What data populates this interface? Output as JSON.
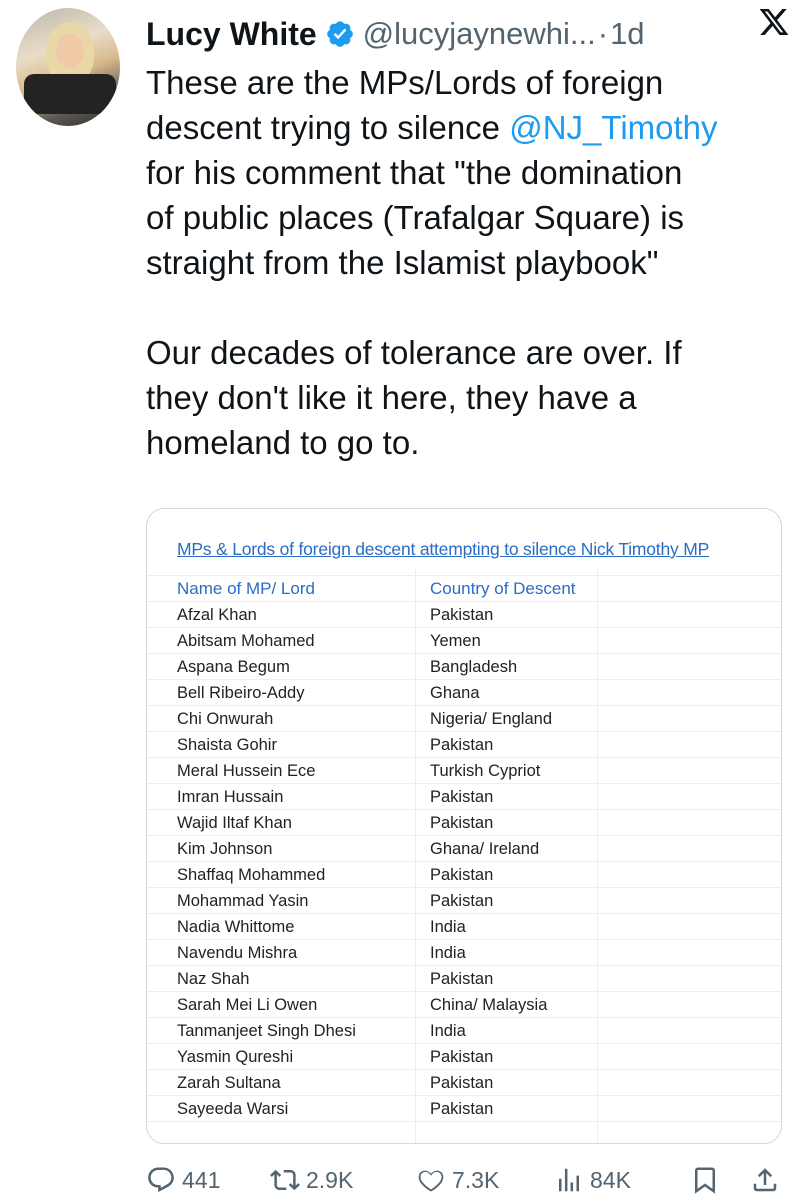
{
  "author": {
    "name": "Lucy White",
    "handle": "@lucyjaynewhi...",
    "separator": "·",
    "time": "1d"
  },
  "icons": {
    "verified": "verified-badge-icon",
    "logo": "x-logo-icon",
    "reply": "reply-icon",
    "repost": "repost-icon",
    "like": "like-icon",
    "views": "views-icon",
    "bookmark": "bookmark-icon",
    "share": "share-icon"
  },
  "colors": {
    "accent": "#1d9bf0",
    "muted": "#536471",
    "sheet_blue": "#2b6cc4"
  },
  "tweet": {
    "line1": "These are the MPs/Lords of foreign",
    "line2_pre": "descent trying to silence ",
    "mention": "@NJ_Timothy",
    "line3": "for his comment that \"the domination",
    "line4": "of public places (Trafalgar Square) is",
    "line5": "straight from the Islamist playbook\"",
    "line6": "Our decades of tolerance are over. If",
    "line7": "they don't like it here, they have a",
    "line8": "homeland to go to."
  },
  "sheet": {
    "title": "MPs & Lords of foreign descent attempting to silence Nick Timothy MP",
    "header_name": "Name of MP/ Lord",
    "header_country": "Country of Descent",
    "rows": [
      {
        "name": "Afzal Khan",
        "country": "Pakistan"
      },
      {
        "name": "Abitsam Mohamed",
        "country": "Yemen"
      },
      {
        "name": "Aspana Begum",
        "country": "Bangladesh"
      },
      {
        "name": "Bell Ribeiro-Addy",
        "country": "Ghana"
      },
      {
        "name": "Chi Onwurah",
        "country": "Nigeria/ England"
      },
      {
        "name": "Shaista Gohir",
        "country": "Pakistan"
      },
      {
        "name": "Meral Hussein Ece",
        "country": "Turkish Cypriot"
      },
      {
        "name": "Imran Hussain",
        "country": "Pakistan"
      },
      {
        "name": "Wajid Iltaf Khan",
        "country": "Pakistan"
      },
      {
        "name": "Kim Johnson",
        "country": "Ghana/ Ireland"
      },
      {
        "name": "Shaffaq Mohammed",
        "country": "Pakistan"
      },
      {
        "name": "Mohammad Yasin",
        "country": "Pakistan"
      },
      {
        "name": "Nadia Whittome",
        "country": "India"
      },
      {
        "name": "Navendu Mishra",
        "country": "India"
      },
      {
        "name": "Naz Shah",
        "country": "Pakistan"
      },
      {
        "name": "Sarah Mei Li Owen",
        "country": "China/ Malaysia"
      },
      {
        "name": "Tanmanjeet Singh Dhesi",
        "country": "India"
      },
      {
        "name": "Yasmin Qureshi",
        "country": "Pakistan"
      },
      {
        "name": "Zarah Sultana",
        "country": "Pakistan"
      },
      {
        "name": "Sayeeda Warsi",
        "country": "Pakistan"
      }
    ]
  },
  "metrics": {
    "replies": "441",
    "reposts": "2.9K",
    "likes": "7.3K",
    "views": "84K"
  }
}
